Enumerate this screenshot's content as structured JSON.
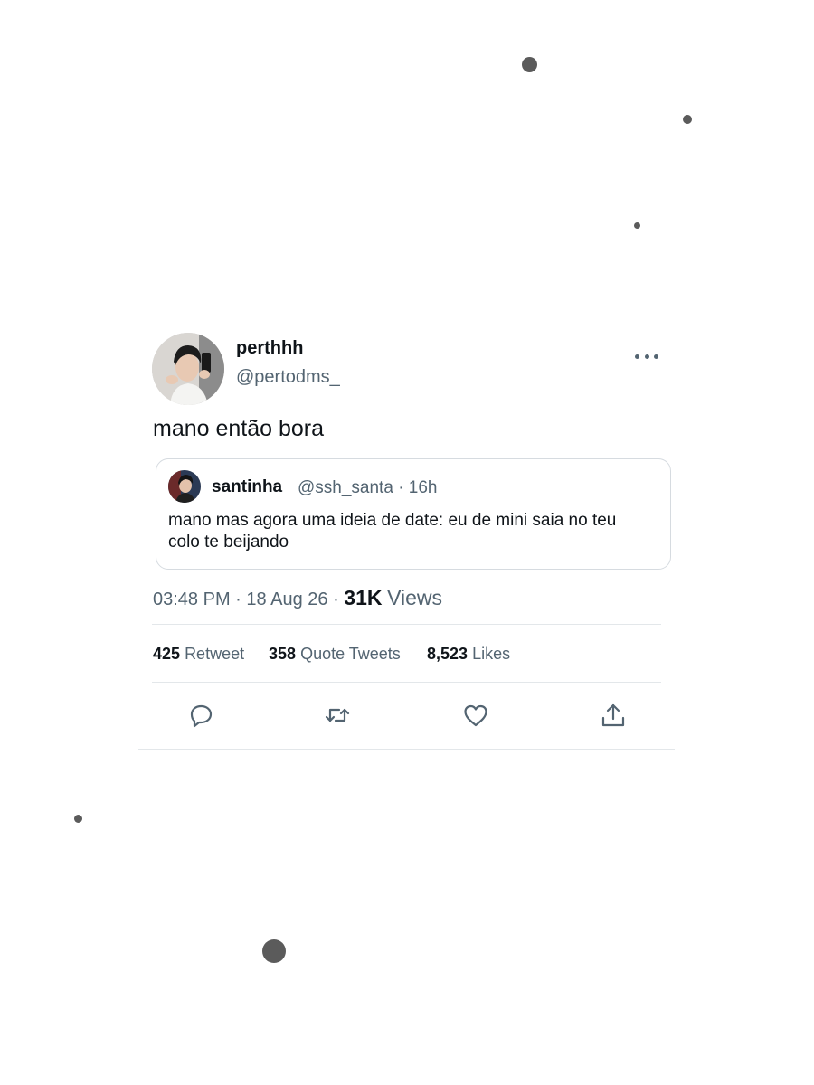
{
  "tweet": {
    "author": {
      "display_name": "perthhh",
      "handle": "@pertodms_"
    },
    "text": "mano então bora",
    "quoted": {
      "display_name": "santinha",
      "handle": "@ssh_santa",
      "age": "16h",
      "separator": "·",
      "text": "mano mas agora uma ideia de date: eu de mini saia no teu colo te beijando"
    },
    "time": "03:48 PM",
    "date": "18 Aug 26",
    "separator": "·",
    "views_count": "31K",
    "views_label": "Views",
    "stats": {
      "retweets": "425",
      "retweets_label": "Retweet",
      "quotes": "358",
      "quotes_label": "Quote Tweets",
      "likes": "8,523",
      "likes_label": "Likes"
    }
  },
  "colors": {
    "text": "#0f1419",
    "secondary": "#536471",
    "border": "#d6dbe0",
    "decor_dot": "#5b5b5b"
  },
  "icons": [
    "more-icon",
    "reply-icon",
    "retweet-icon",
    "like-icon",
    "share-icon"
  ]
}
